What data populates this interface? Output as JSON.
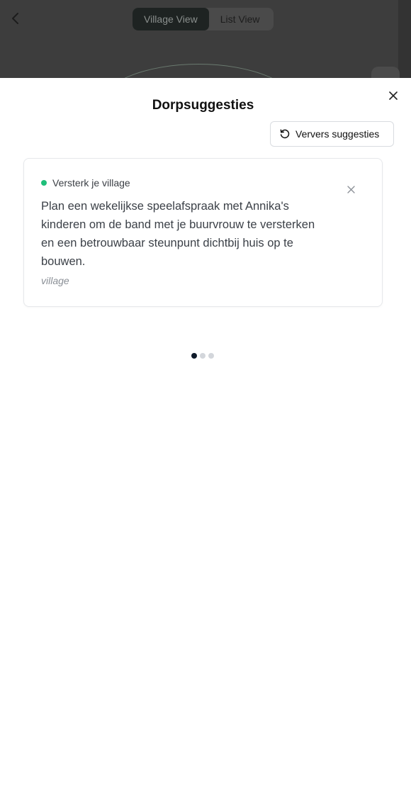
{
  "header": {
    "back_icon": "chevron-left-icon",
    "view_toggle": {
      "options": [
        "Village View",
        "List View"
      ],
      "selected": "Village View"
    }
  },
  "sheet": {
    "title": "Dorpsuggesties",
    "close_icon": "close-icon",
    "refresh_button": {
      "icon": "refresh-icon",
      "label": "Ververs suggesties"
    },
    "suggestion": {
      "tag": "Versterk je village",
      "tag_color": "#1fbf7a",
      "text": "Plan een wekelijkse speelafspraak met Annika's kinderen om de band met je buurvrouw te versterken en een betrouwbaar steunpunt dichtbij huis op te bouwen.",
      "category": "village",
      "dismiss_icon": "close-icon"
    },
    "pager": {
      "count": 3,
      "active_index": 0
    }
  }
}
